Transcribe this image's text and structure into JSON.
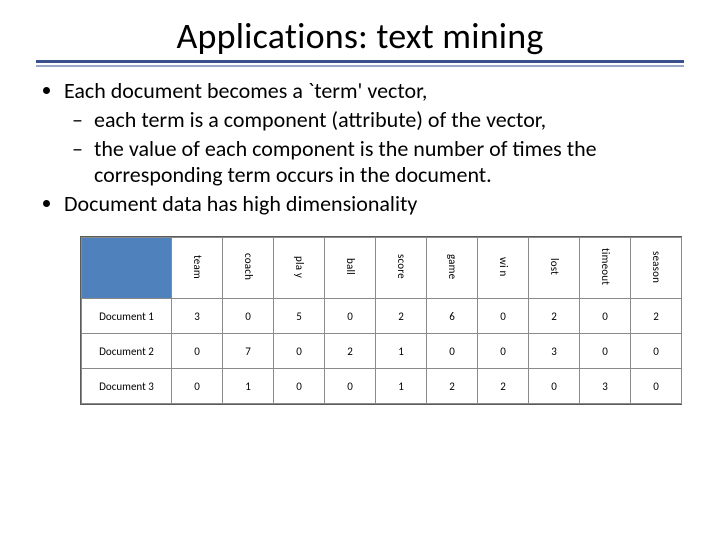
{
  "title": "Applications: text mining",
  "bullets": {
    "b1": "Each document becomes a `term' vector,",
    "b1_sub1": "each term is a component (attribute) of the vector,",
    "b1_sub2": "the value of each component is the number of times the corresponding term occurs in the document.",
    "b2": "Document data has high dimensionality"
  },
  "table": {
    "terms": [
      "team",
      "coach",
      "pla y",
      "ball",
      "score",
      "game",
      "wi n",
      "lost",
      "timeout",
      "season"
    ],
    "rows": [
      {
        "label": "Document 1",
        "cells": [
          "3",
          "0",
          "5",
          "0",
          "2",
          "6",
          "0",
          "2",
          "0",
          "2"
        ]
      },
      {
        "label": "Document 2",
        "cells": [
          "0",
          "7",
          "0",
          "2",
          "1",
          "0",
          "0",
          "3",
          "0",
          "0"
        ]
      },
      {
        "label": "Document 3",
        "cells": [
          "0",
          "1",
          "0",
          "0",
          "1",
          "2",
          "2",
          "0",
          "3",
          "0"
        ]
      }
    ]
  },
  "chart_data": {
    "type": "table",
    "title": "Term-document matrix",
    "columns": [
      "team",
      "coach",
      "play",
      "ball",
      "score",
      "game",
      "win",
      "lost",
      "timeout",
      "season"
    ],
    "rows": [
      "Document 1",
      "Document 2",
      "Document 3"
    ],
    "values": [
      [
        3,
        0,
        5,
        0,
        2,
        6,
        0,
        2,
        0,
        2
      ],
      [
        0,
        7,
        0,
        2,
        1,
        0,
        0,
        3,
        0,
        0
      ],
      [
        0,
        1,
        0,
        0,
        1,
        2,
        2,
        0,
        3,
        0
      ]
    ]
  }
}
